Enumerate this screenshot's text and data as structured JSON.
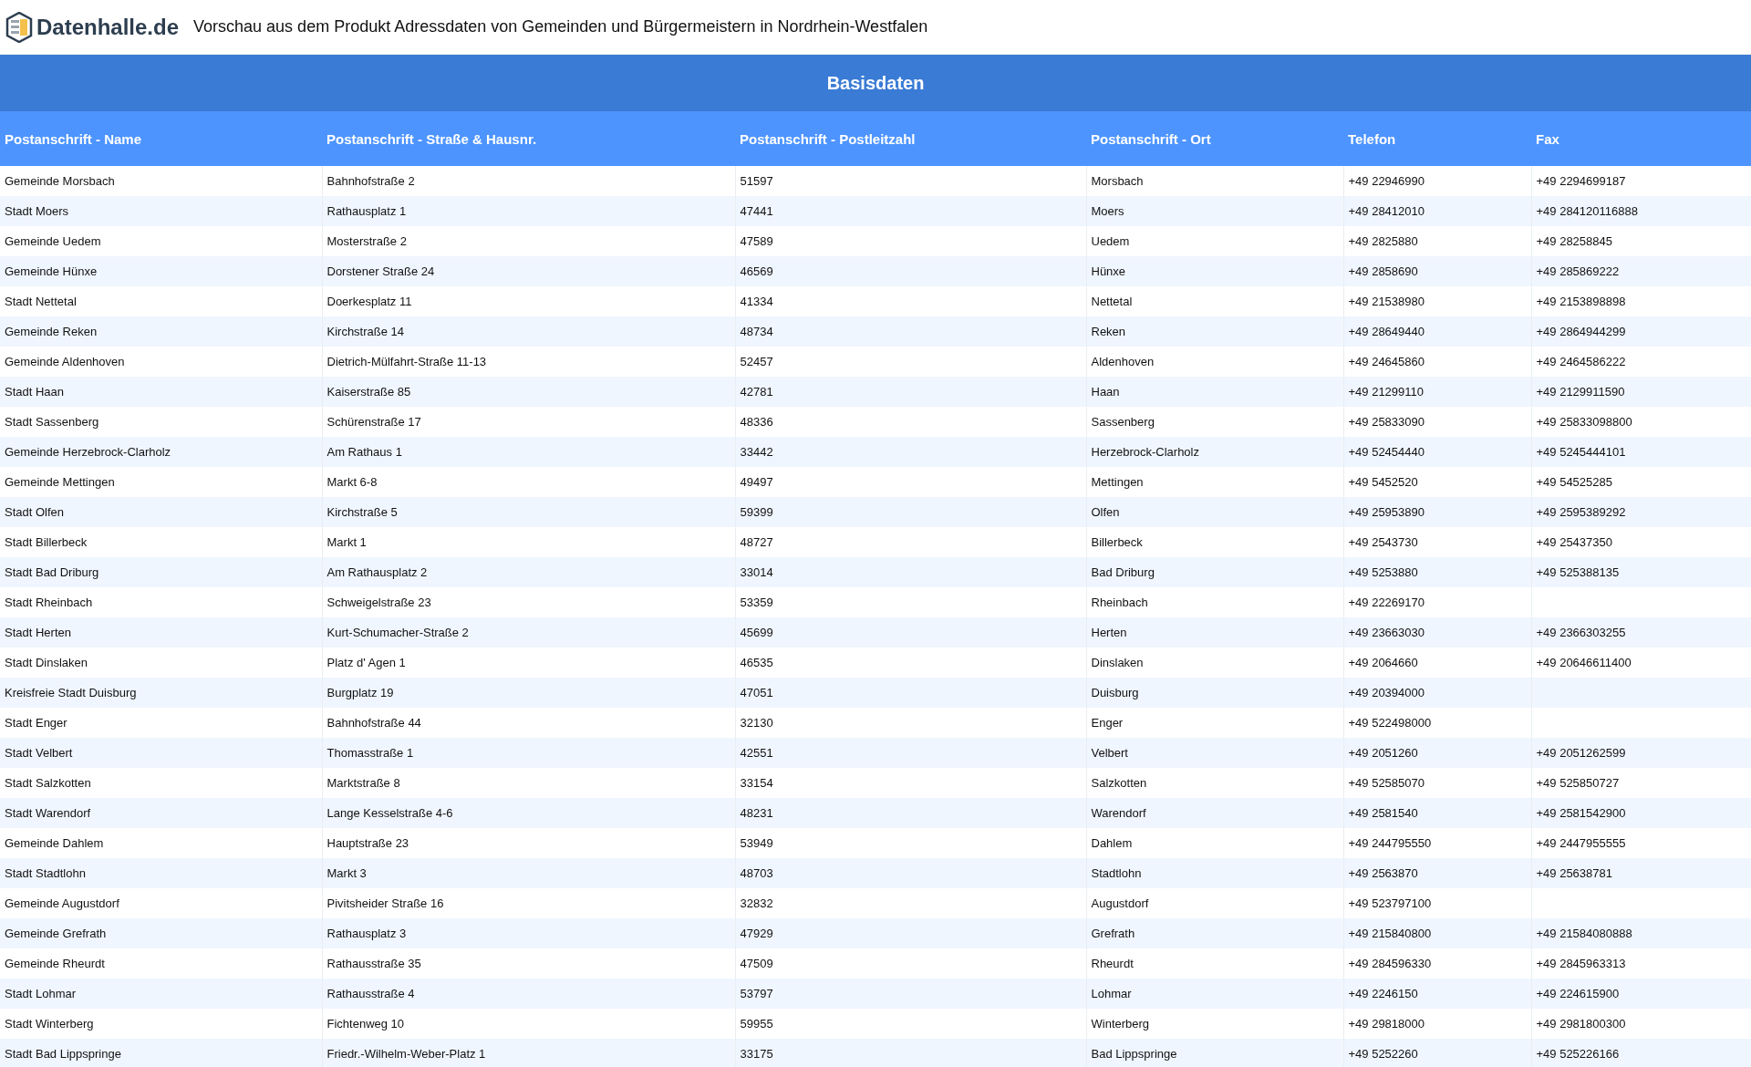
{
  "header": {
    "logo_text": "Datenhalle.de",
    "title": "Vorschau aus dem Produkt Adressdaten von Gemeinden und Bürgermeistern in Nordrhein-Westfalen"
  },
  "table": {
    "group_title": "Basisdaten",
    "columns": [
      "Postanschrift - Name",
      "Postanschrift - Straße & Hausnr.",
      "Postanschrift - Postleitzahl",
      "Postanschrift - Ort",
      "Telefon",
      "Fax"
    ],
    "rows": [
      [
        "Gemeinde Morsbach",
        "Bahnhofstraße 2",
        "51597",
        "Morsbach",
        "+49 22946990",
        "+49 2294699187"
      ],
      [
        "Stadt Moers",
        "Rathausplatz 1",
        "47441",
        "Moers",
        "+49 28412010",
        "+49 284120116888"
      ],
      [
        "Gemeinde Uedem",
        "Mosterstraße 2",
        "47589",
        "Uedem",
        "+49 2825880",
        "+49 28258845"
      ],
      [
        "Gemeinde Hünxe",
        "Dorstener Straße 24",
        "46569",
        "Hünxe",
        "+49 2858690",
        "+49 285869222"
      ],
      [
        "Stadt Nettetal",
        "Doerkesplatz 11",
        "41334",
        "Nettetal",
        "+49 21538980",
        "+49 2153898898"
      ],
      [
        "Gemeinde Reken",
        "Kirchstraße 14",
        "48734",
        "Reken",
        "+49 28649440",
        "+49 2864944299"
      ],
      [
        "Gemeinde Aldenhoven",
        "Dietrich-Mülfahrt-Straße 11-13",
        "52457",
        "Aldenhoven",
        "+49 24645860",
        "+49 2464586222"
      ],
      [
        "Stadt Haan",
        "Kaiserstraße 85",
        "42781",
        "Haan",
        "+49 21299110",
        "+49 2129911590"
      ],
      [
        "Stadt Sassenberg",
        "Schürenstraße 17",
        "48336",
        "Sassenberg",
        "+49 25833090",
        "+49 25833098800"
      ],
      [
        "Gemeinde Herzebrock-Clarholz",
        "Am Rathaus 1",
        "33442",
        "Herzebrock-Clarholz",
        "+49 52454440",
        "+49 5245444101"
      ],
      [
        "Gemeinde Mettingen",
        "Markt 6-8",
        "49497",
        "Mettingen",
        "+49 5452520",
        "+49 54525285"
      ],
      [
        "Stadt Olfen",
        "Kirchstraße 5",
        "59399",
        "Olfen",
        "+49 25953890",
        "+49 2595389292"
      ],
      [
        "Stadt Billerbeck",
        "Markt 1",
        "48727",
        "Billerbeck",
        "+49 2543730",
        "+49 25437350"
      ],
      [
        "Stadt Bad Driburg",
        "Am Rathausplatz 2",
        "33014",
        "Bad Driburg",
        "+49 5253880",
        "+49 525388135"
      ],
      [
        "Stadt Rheinbach",
        "Schweigelstraße 23",
        "53359",
        "Rheinbach",
        "+49 22269170"
      ],
      [
        "Stadt Herten",
        "Kurt-Schumacher-Straße 2",
        "45699",
        "Herten",
        "+49 23663030",
        "+49 2366303255"
      ],
      [
        "Stadt Dinslaken",
        "Platz d' Agen 1",
        "46535",
        "Dinslaken",
        "+49 2064660",
        "+49 20646611400"
      ],
      [
        "Kreisfreie Stadt Duisburg",
        "Burgplatz 19",
        "47051",
        "Duisburg",
        "+49 20394000"
      ],
      [
        "Stadt Enger",
        "Bahnhofstraße 44",
        "32130",
        "Enger",
        "+49 522498000"
      ],
      [
        "Stadt Velbert",
        "Thomasstraße 1",
        "42551",
        "Velbert",
        "+49 2051260",
        "+49 2051262599"
      ],
      [
        "Stadt Salzkotten",
        "Marktstraße 8",
        "33154",
        "Salzkotten",
        "+49 52585070",
        "+49 525850727"
      ],
      [
        "Stadt Warendorf",
        "Lange Kesselstraße 4-6",
        "48231",
        "Warendorf",
        "+49 2581540",
        "+49 2581542900"
      ],
      [
        "Gemeinde Dahlem",
        "Hauptstraße 23",
        "53949",
        "Dahlem",
        "+49 244795550",
        "+49 2447955555"
      ],
      [
        "Stadt Stadtlohn",
        "Markt 3",
        "48703",
        "Stadtlohn",
        "+49 2563870",
        "+49 25638781"
      ],
      [
        "Gemeinde Augustdorf",
        "Pivitsheider Straße 16",
        "32832",
        "Augustdorf",
        "+49 523797100"
      ],
      [
        "Gemeinde Grefrath",
        "Rathausplatz 3",
        "47929",
        "Grefrath",
        "+49 215840800",
        "+49 21584080888"
      ],
      [
        "Gemeinde Rheurdt",
        "Rathausstraße 35",
        "47509",
        "Rheurdt",
        "+49 284596330",
        "+49 2845963313"
      ],
      [
        "Stadt Lohmar",
        "Rathausstraße 4",
        "53797",
        "Lohmar",
        "+49 2246150",
        "+49 224615900"
      ],
      [
        "Stadt Winterberg",
        "Fichtenweg 10",
        "59955",
        "Winterberg",
        "+49 29818000",
        "+49 2981800300"
      ],
      [
        "Stadt Bad Lippspringe",
        "Friedr.-Wilhelm-Weber-Platz 1",
        "33175",
        "Bad Lippspringe",
        "+49 5252260",
        "+49 525226166"
      ]
    ]
  }
}
